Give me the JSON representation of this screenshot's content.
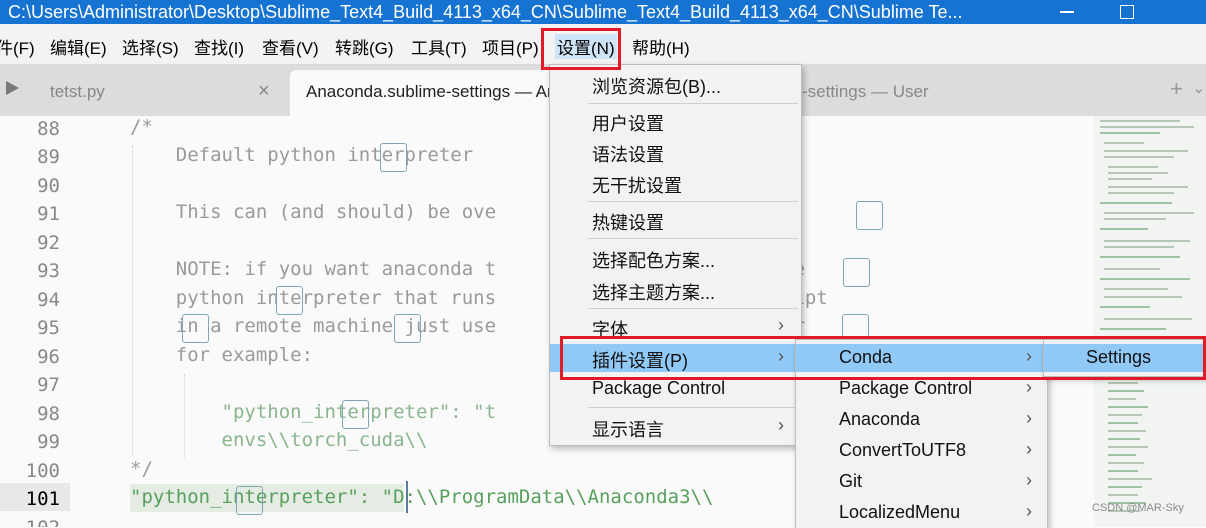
{
  "window": {
    "title": "C:\\Users\\Administrator\\Desktop\\Sublime_Text4_Build_4113_x64_CN\\Sublime_Text4_Build_4113_x64_CN\\Sublime Te..."
  },
  "menubar": {
    "items": [
      "件(F)",
      "编辑(E)",
      "选择(S)",
      "查找(I)",
      "查看(V)",
      "转跳(G)",
      "工具(T)",
      "项目(P)",
      "设置(N)",
      "帮助(H)"
    ]
  },
  "tabs": [
    {
      "label": "tetst.py",
      "close": "×"
    },
    {
      "label": "Anaconda.sublime-settings — An",
      "close": "×"
    },
    {
      "label": "-settings — User",
      "close": ""
    }
  ],
  "tabbar": {
    "plus": "+",
    "chevron": "⌄"
  },
  "editor": {
    "line_numbers": [
      "88",
      "89",
      "90",
      "91",
      "92",
      "93",
      "94",
      "95",
      "96",
      "97",
      "98",
      "99",
      "100",
      "101",
      "102"
    ],
    "current_line": "101",
    "lines": [
      "/*",
      "    Default python interpreter",
      "",
      "    This can (and should) be ove             settings.",
      "",
      "    NOTE: if you want anaconda t             using a remote",
      "    python interpreter that runs             server.py script",
      "    in a remote machine just use             as interpreter",
      "    for example:",
      "",
      "        \"python_interpreter\": \"t",
      "        envs\\\\torch_cuda\\\\",
      "*/",
      "\"python_interpreter\": \"D:\\\\ProgramData\\\\Anaconda3\\\\             pytho",
      ""
    ]
  },
  "settings_menu": {
    "items": [
      {
        "label": "浏览资源包(B)...",
        "arrow": ""
      },
      {
        "label": "用户设置",
        "arrow": ""
      },
      {
        "label": "语法设置",
        "arrow": ""
      },
      {
        "label": "无干扰设置",
        "arrow": ""
      },
      {
        "label": "热键设置",
        "arrow": ""
      },
      {
        "label": "选择配色方案...",
        "arrow": ""
      },
      {
        "label": "选择主题方案...",
        "arrow": ""
      },
      {
        "label": "字体",
        "arrow": "›"
      },
      {
        "label": "插件设置(P)",
        "arrow": "›"
      },
      {
        "label": "Package Control",
        "arrow": ""
      },
      {
        "label": "显示语言",
        "arrow": "›"
      }
    ]
  },
  "plugin_menu": {
    "items": [
      {
        "label": "Conda",
        "arrow": "›"
      },
      {
        "label": "Package Control",
        "arrow": "›"
      },
      {
        "label": "Anaconda",
        "arrow": "›"
      },
      {
        "label": "ConvertToUTF8",
        "arrow": "›"
      },
      {
        "label": "Git",
        "arrow": "›"
      },
      {
        "label": "LocalizedMenu",
        "arrow": "›"
      }
    ]
  },
  "conda_menu": {
    "items": [
      {
        "label": "Settings"
      }
    ]
  },
  "watermark": "CSDN @MAR-Sky",
  "colors": {
    "titlebar": "#1673d2",
    "highlight": "#90c8f6",
    "callout_red": "#e01a26"
  }
}
